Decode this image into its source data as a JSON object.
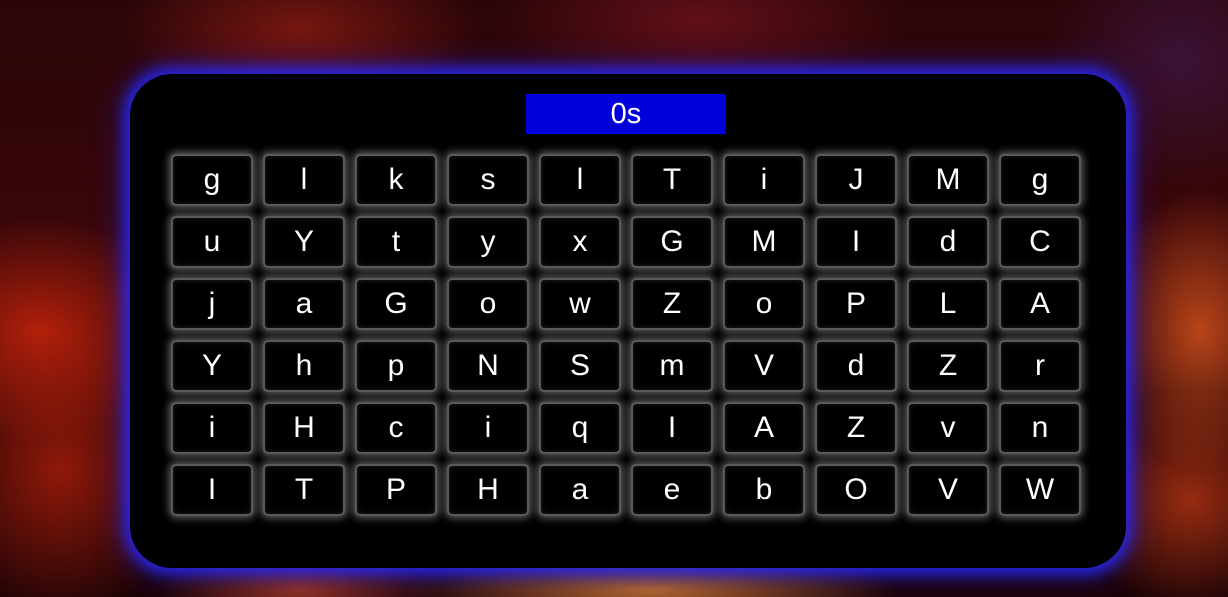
{
  "timer": {
    "text": "0s",
    "color": "#0000dd"
  },
  "colors": {
    "board": "#000000",
    "glow": "#2828ff",
    "tile_text": "#ffffff"
  },
  "grid": {
    "rows": [
      [
        "g",
        "l",
        "k",
        "s",
        "l",
        "T",
        "i",
        "J",
        "M",
        "g"
      ],
      [
        "u",
        "Y",
        "t",
        "y",
        "x",
        "G",
        "M",
        "I",
        "d",
        "C"
      ],
      [
        "j",
        "a",
        "G",
        "o",
        "w",
        "Z",
        "o",
        "P",
        "L",
        "A"
      ],
      [
        "Y",
        "h",
        "p",
        "N",
        "S",
        "m",
        "V",
        "d",
        "Z",
        "r"
      ],
      [
        "i",
        "H",
        "c",
        "i",
        "q",
        "I",
        "A",
        "Z",
        "v",
        "n"
      ],
      [
        "I",
        "T",
        "P",
        "H",
        "a",
        "e",
        "b",
        "O",
        "V",
        "W"
      ]
    ]
  }
}
